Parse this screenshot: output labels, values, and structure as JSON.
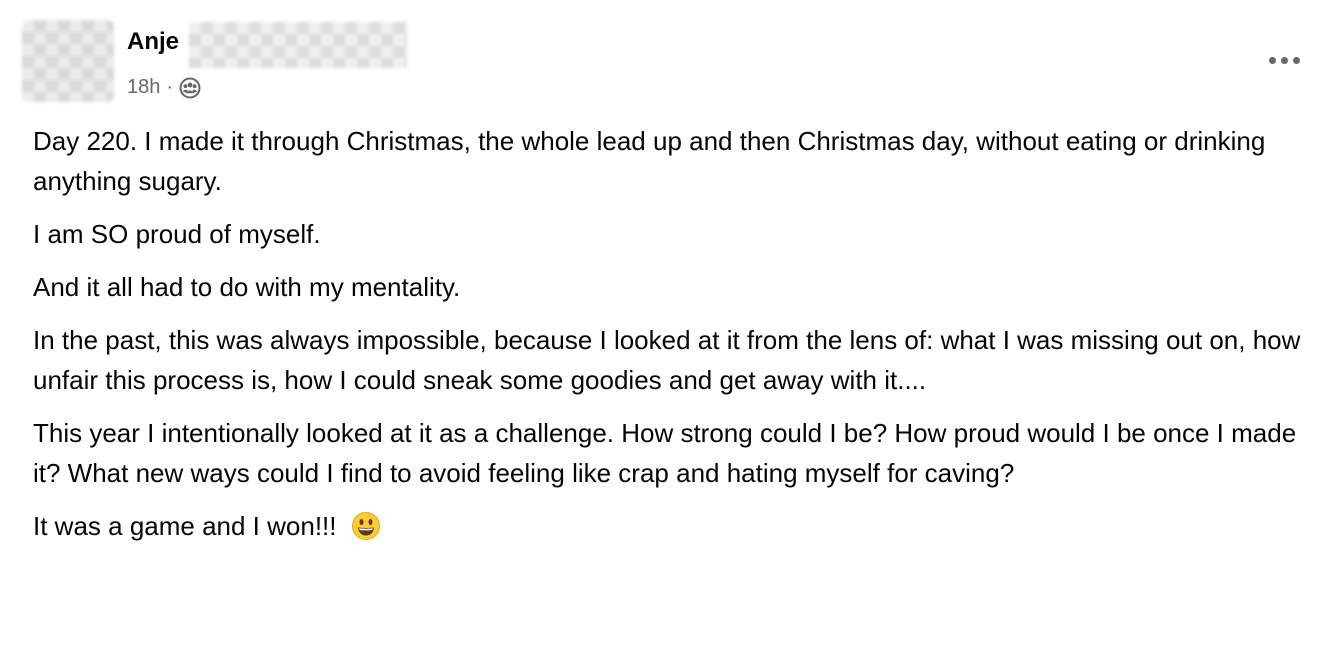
{
  "post": {
    "author": "Anje",
    "timestamp": "18h",
    "separator": "·",
    "privacy_icon": "group-audience-icon",
    "more_icon": "ellipsis-icon",
    "paragraphs": [
      "Day 220.  I made it through Christmas, the whole lead up and then Christmas day, without eating or drinking anything sugary.",
      "I am SO proud of myself.",
      "And it all had to do with my mentality.",
      "In the past, this was always impossible, because I looked at it from the lens of:  what I was missing out on, how unfair this process is, how I could sneak some goodies and get away with it....",
      "This year I intentionally looked at it as a challenge.  How strong could I be?  How proud would I be once I made it?  What new ways could I find to avoid feeling like crap and hating myself for caving?",
      "It was a game and I won!!!"
    ],
    "final_emoji": "grinning-face-emoji"
  },
  "colors": {
    "text": "#050505",
    "secondary_text": "#65676b",
    "background": "#ffffff"
  }
}
